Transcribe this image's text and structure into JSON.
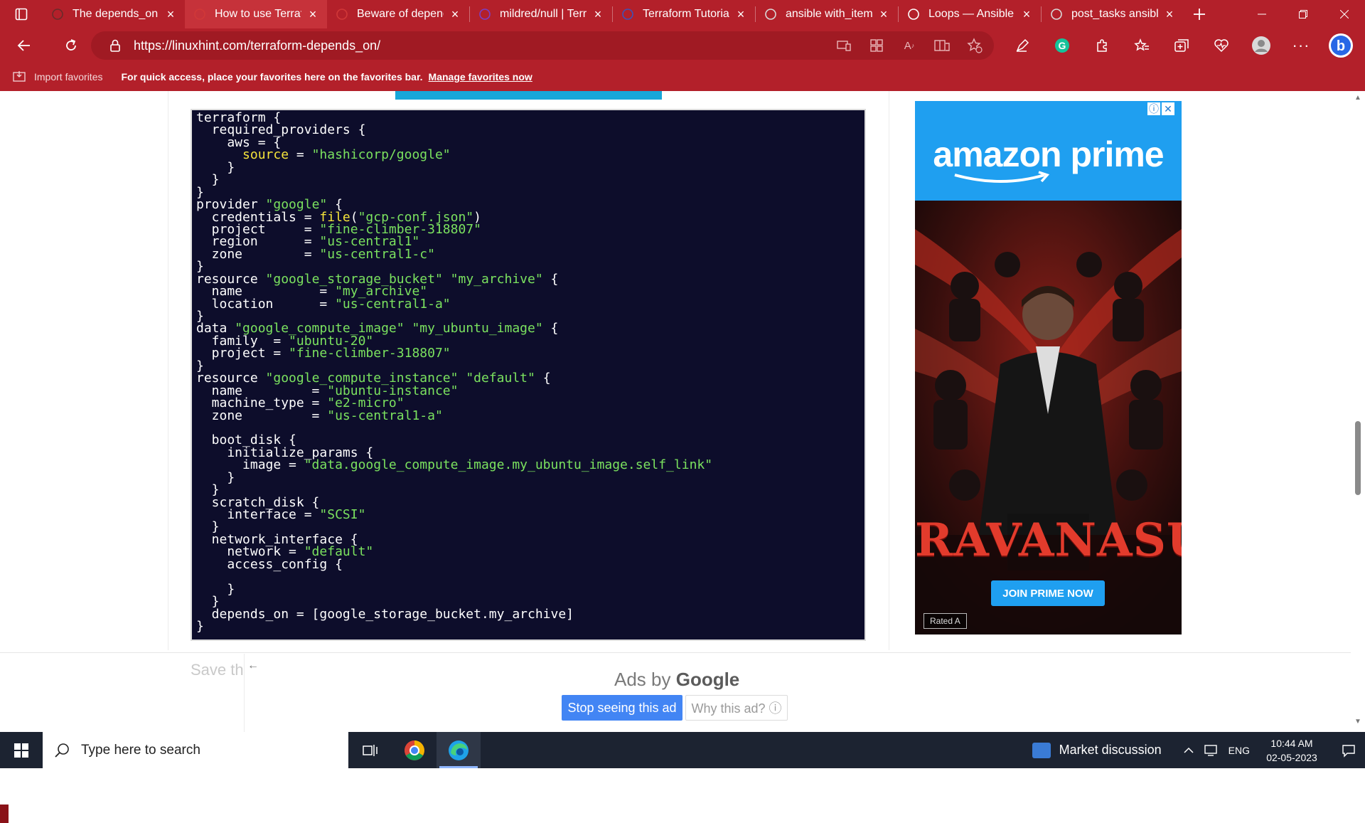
{
  "browser": {
    "tabs": [
      {
        "label": "The depends_on M",
        "active": false
      },
      {
        "label": "How to use Terraf",
        "active": true
      },
      {
        "label": "Beware of depend",
        "active": false
      },
      {
        "label": "mildred/null | Terr",
        "active": false
      },
      {
        "label": "Terraform Tutorial",
        "active": false
      },
      {
        "label": "ansible with_item",
        "active": false
      },
      {
        "label": "Loops — Ansible",
        "active": false
      },
      {
        "label": "post_tasks ansible",
        "active": false
      }
    ],
    "url": "https://linuxhint.com/terraform-depends_on/",
    "favorites_bar": {
      "import_label": "Import favorites",
      "message": "For quick access, place your favorites here on the favorites bar.",
      "manage_link": "Manage favorites now"
    },
    "accent_color": "#b3202a"
  },
  "page": {
    "code_lines": [
      [
        {
          "t": "terraform {",
          "c": ""
        }
      ],
      [
        {
          "t": "  required_providers {",
          "c": ""
        }
      ],
      [
        {
          "t": "    aws = {",
          "c": ""
        }
      ],
      [
        {
          "t": "      ",
          "c": ""
        },
        {
          "t": "source",
          "c": "k"
        },
        {
          "t": " = ",
          "c": ""
        },
        {
          "t": "\"hashicorp/google\"",
          "c": "s"
        }
      ],
      [
        {
          "t": "    }",
          "c": ""
        }
      ],
      [
        {
          "t": "  }",
          "c": ""
        }
      ],
      [
        {
          "t": "}",
          "c": ""
        }
      ],
      [
        {
          "t": "provider ",
          "c": ""
        },
        {
          "t": "\"google\"",
          "c": "s"
        },
        {
          "t": " {",
          "c": ""
        }
      ],
      [
        {
          "t": "  credentials = ",
          "c": ""
        },
        {
          "t": "file",
          "c": "k"
        },
        {
          "t": "(",
          "c": ""
        },
        {
          "t": "\"gcp-conf.json\"",
          "c": "s"
        },
        {
          "t": ")",
          "c": ""
        }
      ],
      [
        {
          "t": "  project     = ",
          "c": ""
        },
        {
          "t": "\"fine-climber-318807\"",
          "c": "s"
        }
      ],
      [
        {
          "t": "  region      = ",
          "c": ""
        },
        {
          "t": "\"us-central1\"",
          "c": "s"
        }
      ],
      [
        {
          "t": "  zone        = ",
          "c": ""
        },
        {
          "t": "\"us-central1-c\"",
          "c": "s"
        }
      ],
      [
        {
          "t": "}",
          "c": ""
        }
      ],
      [
        {
          "t": "resource ",
          "c": ""
        },
        {
          "t": "\"google_storage_bucket\"",
          "c": "s"
        },
        {
          "t": " ",
          "c": ""
        },
        {
          "t": "\"my_archive\"",
          "c": "s"
        },
        {
          "t": " {",
          "c": ""
        }
      ],
      [
        {
          "t": "  name          = ",
          "c": ""
        },
        {
          "t": "\"my_archive\"",
          "c": "s"
        }
      ],
      [
        {
          "t": "  location      = ",
          "c": ""
        },
        {
          "t": "\"us-central1-a\"",
          "c": "s"
        }
      ],
      [
        {
          "t": "}",
          "c": ""
        }
      ],
      [
        {
          "t": "data ",
          "c": ""
        },
        {
          "t": "\"google_compute_image\"",
          "c": "s"
        },
        {
          "t": " ",
          "c": ""
        },
        {
          "t": "\"my_ubuntu_image\"",
          "c": "s"
        },
        {
          "t": " {",
          "c": ""
        }
      ],
      [
        {
          "t": "  family  = ",
          "c": ""
        },
        {
          "t": "\"ubuntu-20\"",
          "c": "s"
        }
      ],
      [
        {
          "t": "  project = ",
          "c": ""
        },
        {
          "t": "\"fine-climber-318807\"",
          "c": "s"
        }
      ],
      [
        {
          "t": "}",
          "c": ""
        }
      ],
      [
        {
          "t": "resource ",
          "c": ""
        },
        {
          "t": "\"google_compute_instance\"",
          "c": "s"
        },
        {
          "t": " ",
          "c": ""
        },
        {
          "t": "\"default\"",
          "c": "s"
        },
        {
          "t": " {",
          "c": ""
        }
      ],
      [
        {
          "t": "  name         = ",
          "c": ""
        },
        {
          "t": "\"ubuntu-instance\"",
          "c": "s"
        }
      ],
      [
        {
          "t": "  machine_type = ",
          "c": ""
        },
        {
          "t": "\"e2-micro\"",
          "c": "s"
        }
      ],
      [
        {
          "t": "  zone         = ",
          "c": ""
        },
        {
          "t": "\"us-central1-a\"",
          "c": "s"
        }
      ],
      [
        {
          "t": "",
          "c": ""
        }
      ],
      [
        {
          "t": "  boot_disk {",
          "c": ""
        }
      ],
      [
        {
          "t": "    initialize_params {",
          "c": ""
        }
      ],
      [
        {
          "t": "      image = ",
          "c": ""
        },
        {
          "t": "\"data.google_compute_image.my_ubuntu_image.self_link\"",
          "c": "s"
        }
      ],
      [
        {
          "t": "    }",
          "c": ""
        }
      ],
      [
        {
          "t": "  }",
          "c": ""
        }
      ],
      [
        {
          "t": "  scratch_disk {",
          "c": ""
        }
      ],
      [
        {
          "t": "    interface = ",
          "c": ""
        },
        {
          "t": "\"SCSI\"",
          "c": "s"
        }
      ],
      [
        {
          "t": "  }",
          "c": ""
        }
      ],
      [
        {
          "t": "  network_interface {",
          "c": ""
        }
      ],
      [
        {
          "t": "    network = ",
          "c": ""
        },
        {
          "t": "\"default\"",
          "c": "s"
        }
      ],
      [
        {
          "t": "    access_config {",
          "c": ""
        }
      ],
      [
        {
          "t": "",
          "c": ""
        }
      ],
      [
        {
          "t": "    }",
          "c": ""
        }
      ],
      [
        {
          "t": "  }",
          "c": ""
        }
      ],
      [
        {
          "t": "  depends_on = [google_storage_bucket.my_archive]",
          "c": ""
        }
      ],
      [
        {
          "t": "}",
          "c": ""
        }
      ]
    ],
    "save_this_label": "Save th",
    "ads_by_prefix": "Ads by ",
    "ads_by_brand": "Google",
    "stop_ad_label": "Stop seeing this ad",
    "why_ad_label": "Why this ad? ⓘ"
  },
  "ad": {
    "brand": "amazon prime",
    "movie_title": "RAVANASURA",
    "cta": "JOIN PRIME NOW",
    "rating": "Rated A",
    "brand_color": "#1f9ff0"
  },
  "taskbar": {
    "search_placeholder": "Type here to search",
    "weather_label": "Market discussion",
    "language": "ENG",
    "time": "10:44 AM",
    "date": "02-05-2023"
  }
}
